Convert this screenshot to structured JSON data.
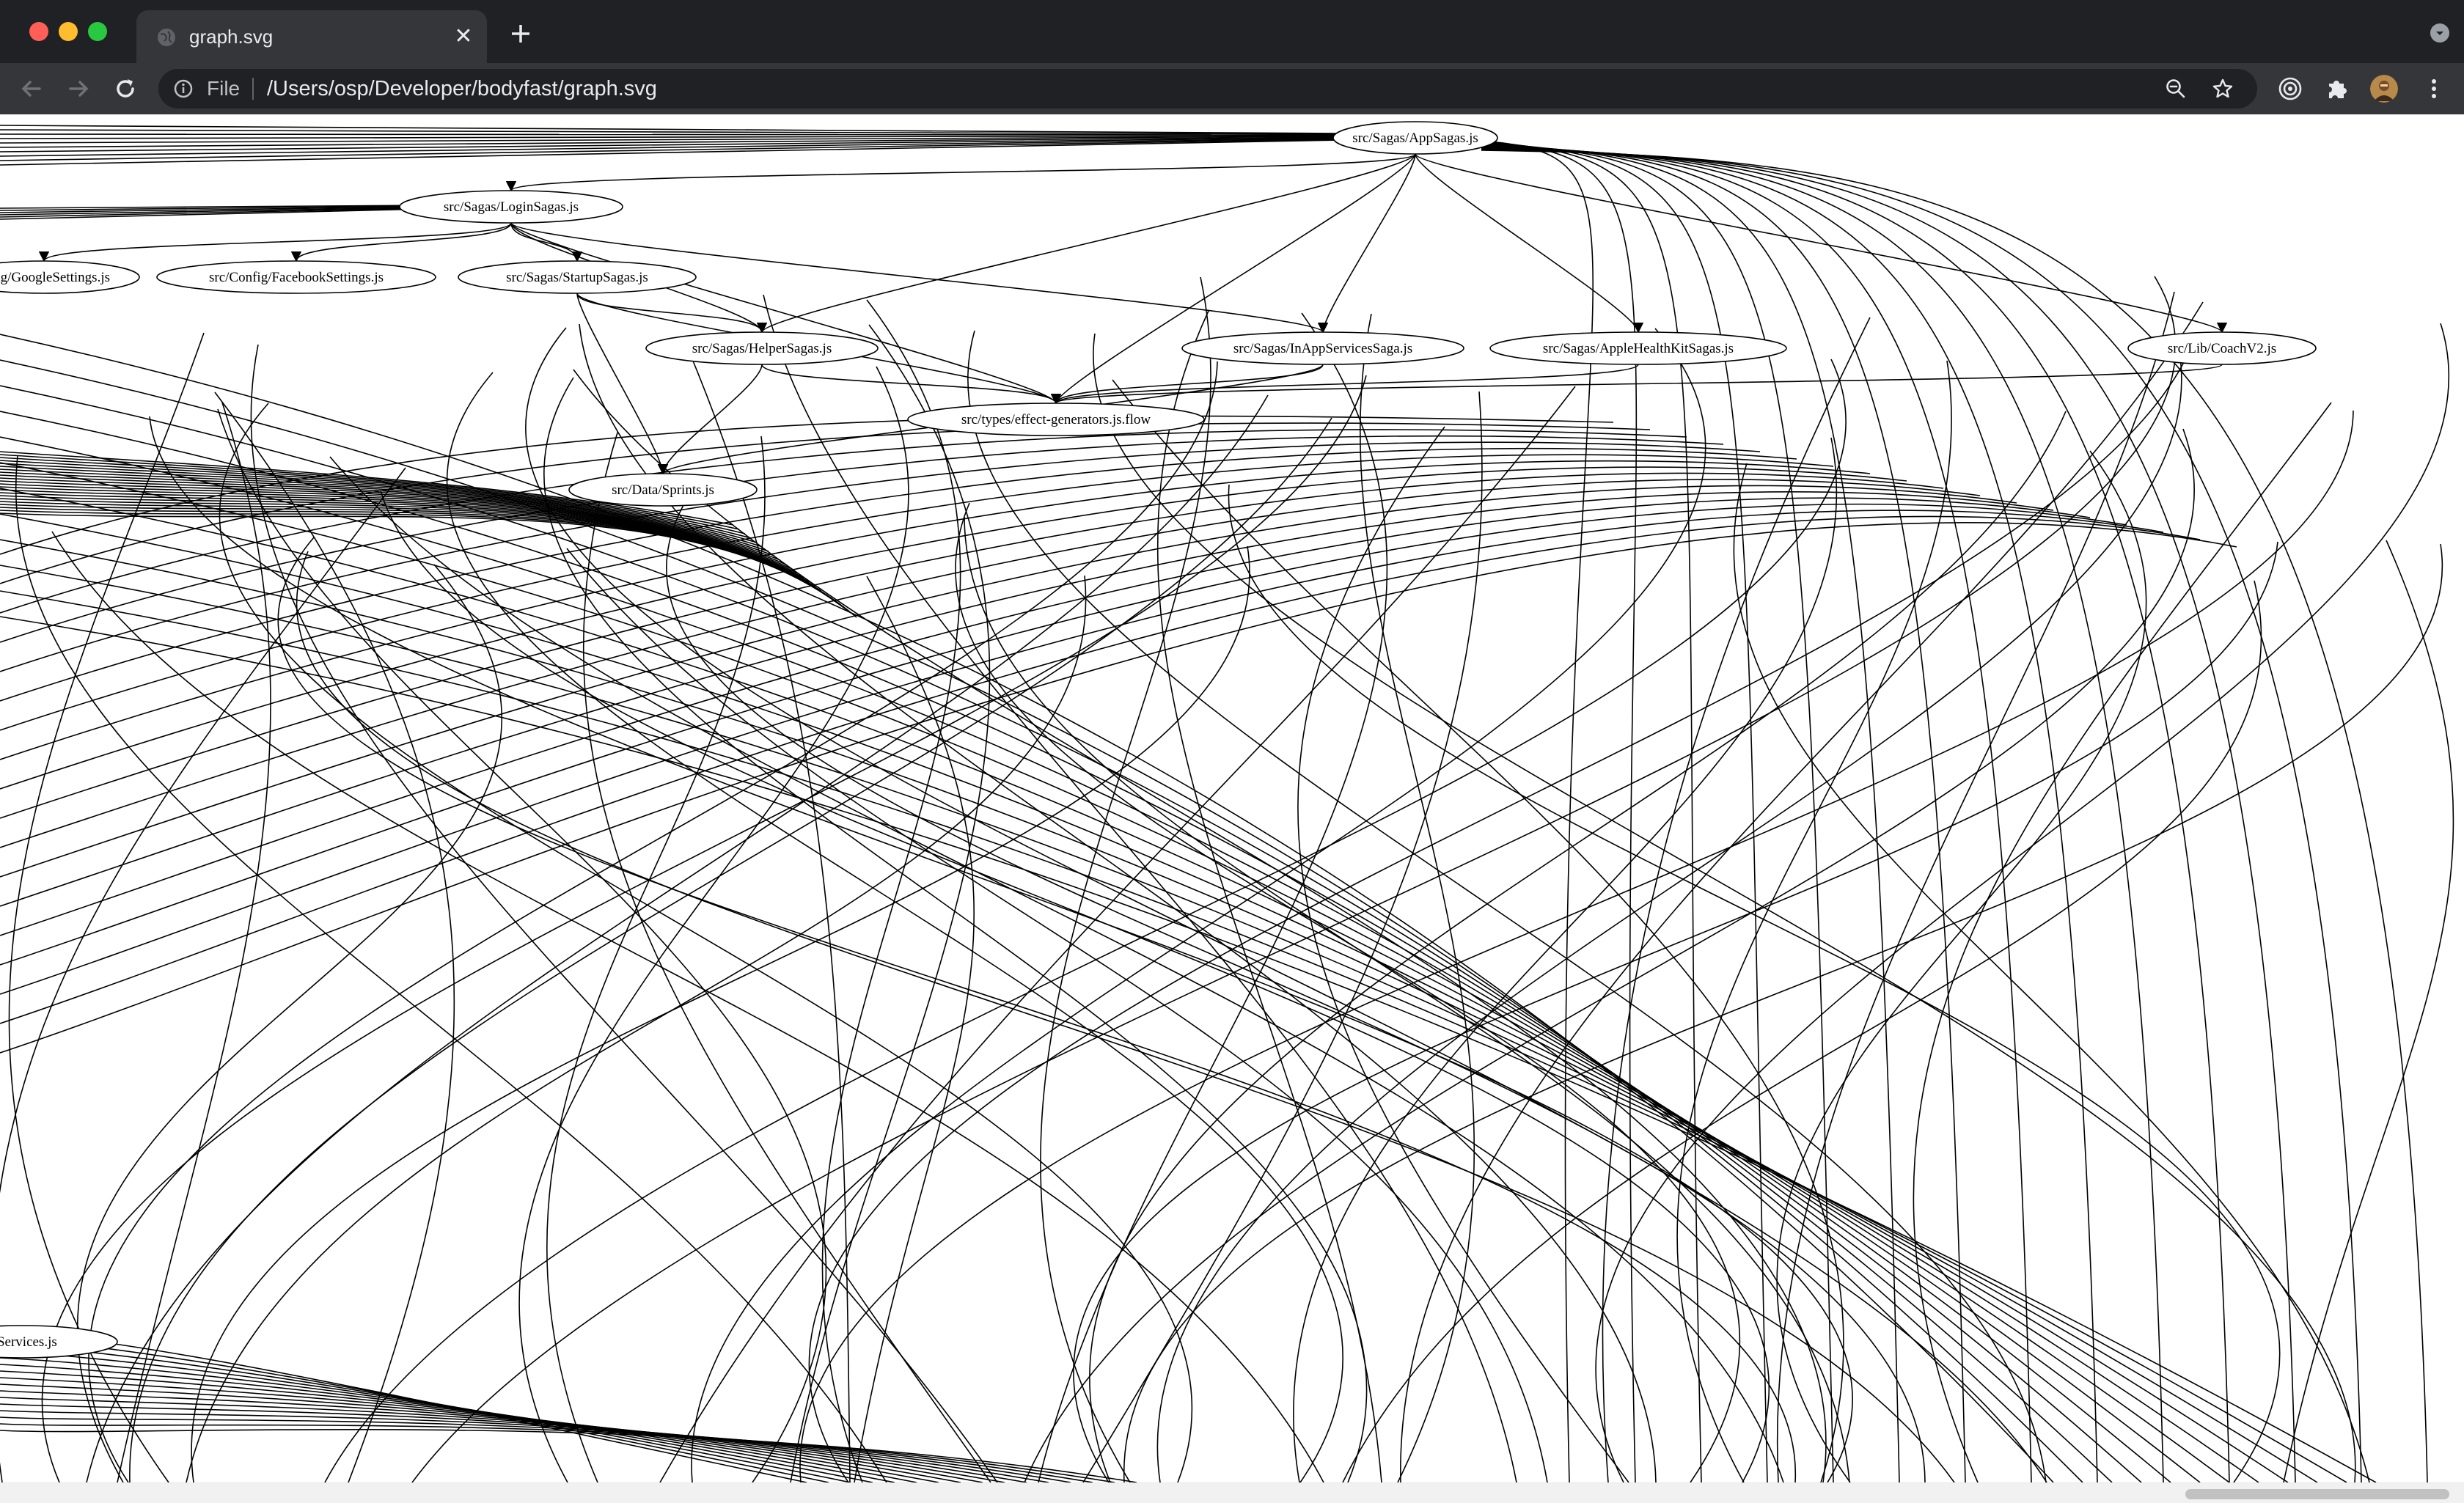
{
  "tab": {
    "title": "graph.svg",
    "close_symbol": "✕"
  },
  "toolbar": {
    "scheme_label": "File",
    "url": "/Users/osp/Developer/bodyfast/graph.svg"
  },
  "graph": {
    "nodes": [
      {
        "id": "app",
        "label": "src/Sagas/AppSagas.js"
      },
      {
        "id": "login",
        "label": "src/Sagas/LoginSagas.js"
      },
      {
        "id": "google",
        "label": "onfig/GoogleSettings.js"
      },
      {
        "id": "facebook",
        "label": "src/Config/FacebookSettings.js"
      },
      {
        "id": "startup",
        "label": "src/Sagas/StartupSagas.js"
      },
      {
        "id": "helper",
        "label": "src/Sagas/HelperSagas.js"
      },
      {
        "id": "inapp",
        "label": "src/Sagas/InAppServicesSaga.js"
      },
      {
        "id": "health",
        "label": "src/Sagas/AppleHealthKitSagas.js"
      },
      {
        "id": "coach",
        "label": "src/Lib/CoachV2.js"
      },
      {
        "id": "effects",
        "label": "src/types/effect-generators.js.flow"
      },
      {
        "id": "sprints",
        "label": "src/Data/Sprints.js"
      },
      {
        "id": "services",
        "label": "alServices.js"
      }
    ]
  }
}
